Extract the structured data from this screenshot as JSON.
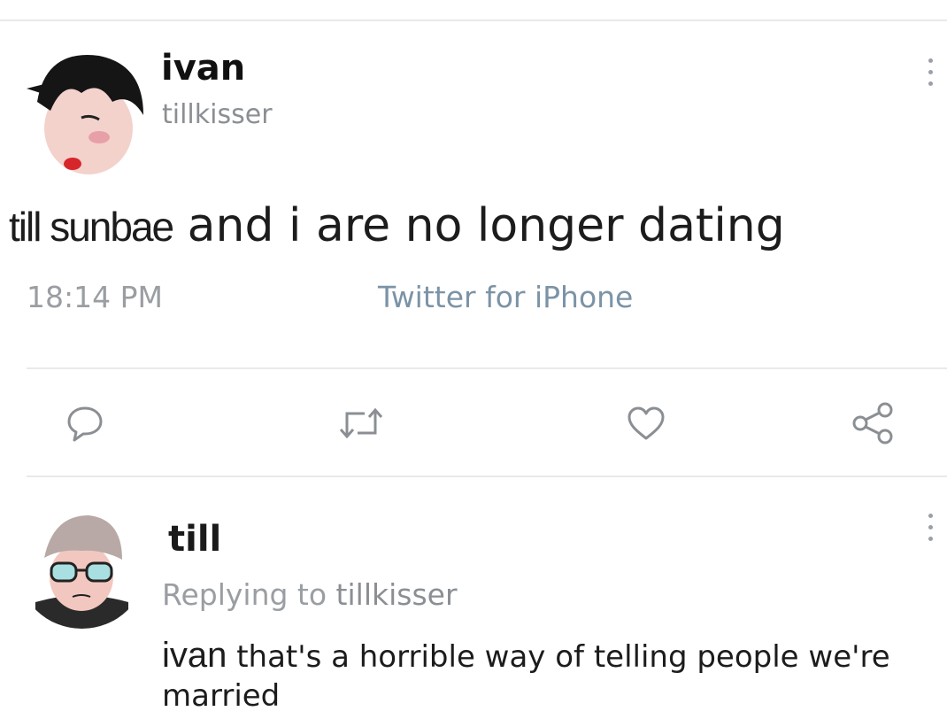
{
  "tweet": {
    "author_name": "ivan",
    "author_handle": "tillkisser",
    "text_mention": "till sunbae",
    "text_body": " and i are no longer dating",
    "time": "18:14 PM",
    "source": "Twitter for iPhone"
  },
  "actions": [
    {
      "icon": "comment-icon"
    },
    {
      "icon": "retweet-icon"
    },
    {
      "icon": "heart-icon"
    },
    {
      "icon": "share-icon"
    }
  ],
  "reply": {
    "author_name": "till",
    "replying_label": "Replying to",
    "replying_handle": "tillkisser",
    "text_mention": "ivan",
    "text_body": " that's a horrible way of telling people we're married"
  },
  "colors": {
    "divider": "#e9e9e9",
    "muted": "#8b8f93",
    "source_link": "#7c93a6",
    "icon": "#8b8f93"
  }
}
